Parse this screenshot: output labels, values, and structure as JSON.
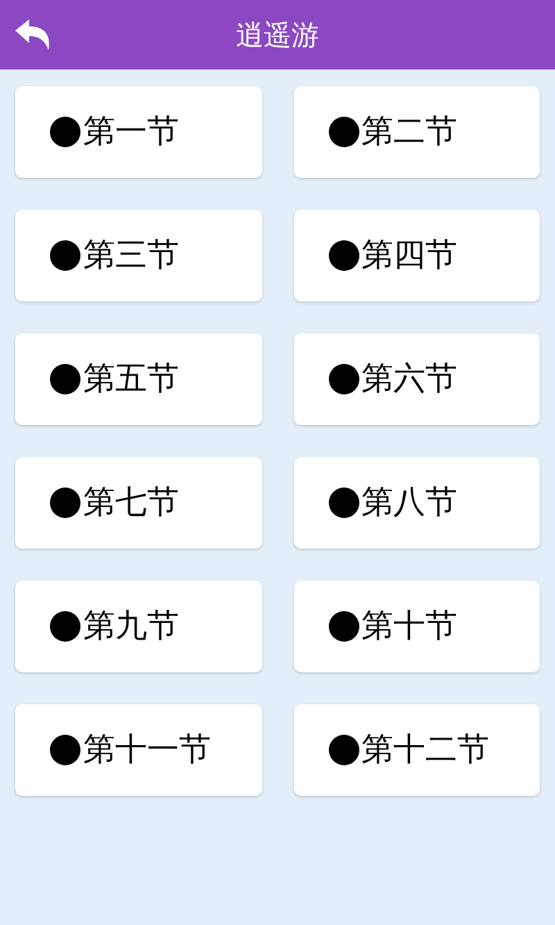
{
  "header": {
    "title": "逍遥游"
  },
  "sections": [
    {
      "label": "第一节"
    },
    {
      "label": "第二节"
    },
    {
      "label": "第三节"
    },
    {
      "label": "第四节"
    },
    {
      "label": "第五节"
    },
    {
      "label": "第六节"
    },
    {
      "label": "第七节"
    },
    {
      "label": "第八节"
    },
    {
      "label": "第九节"
    },
    {
      "label": "第十节"
    },
    {
      "label": "第十一节"
    },
    {
      "label": "第十二节"
    }
  ]
}
